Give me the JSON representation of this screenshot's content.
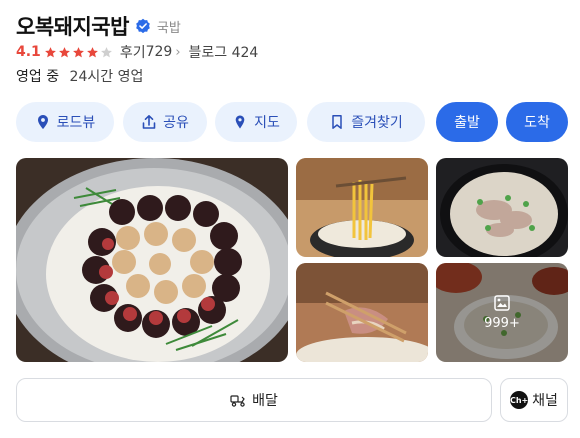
{
  "place": {
    "name": "오복돼지국밥",
    "category": "국밥",
    "rating": "4.1",
    "rating_value": 4.1,
    "review_label": "후기",
    "review_count": "729",
    "blog_label": "블로그",
    "blog_count": "424",
    "status": "영업 중",
    "hours": "24시간 영업"
  },
  "actions": [
    {
      "label": "로드뷰",
      "icon": "location-pin-icon"
    },
    {
      "label": "공유",
      "icon": "share-icon"
    },
    {
      "label": "지도",
      "icon": "map-pin-icon"
    },
    {
      "label": "즐겨찾기",
      "icon": "bookmark-icon"
    },
    {
      "label": "출발"
    },
    {
      "label": "도착"
    }
  ],
  "photos": {
    "more_count": "999+"
  },
  "bottom": {
    "delivery_label": "배달",
    "channel_label": "채널",
    "channel_badge": "Ch+"
  },
  "colors": {
    "accent": "#2b6be8",
    "pill_bg": "#eaf2fd",
    "rating": "#e8473b",
    "verified": "#2b6be8"
  }
}
